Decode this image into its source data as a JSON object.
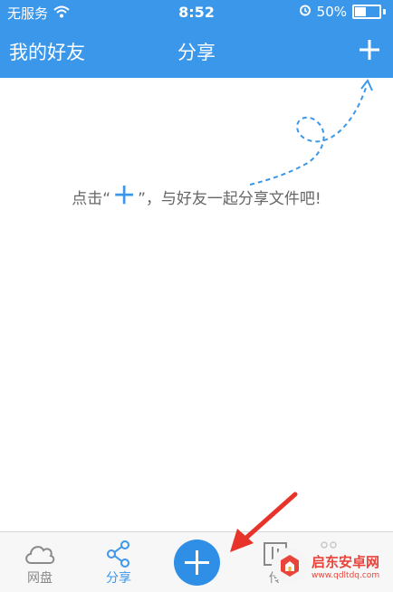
{
  "status_bar": {
    "carrier": "无服务",
    "time": "8:52",
    "battery_percent_label": "50%",
    "battery_level": 0.5
  },
  "nav": {
    "left_label": "我的好友",
    "title": "分享",
    "add_icon": "plus-icon"
  },
  "content": {
    "hint_prefix": "点击“",
    "hint_plus": "＋",
    "hint_suffix": "”，与好友一起分享文件吧!"
  },
  "tabs": [
    {
      "label": "网盘",
      "icon": "cloud-icon",
      "active": false
    },
    {
      "label": "分享",
      "icon": "share-icon",
      "active": true
    },
    {
      "label": "传输",
      "icon": "transfer-icon",
      "active": false
    },
    {
      "label": "",
      "icon": "more-icon",
      "active": false
    }
  ],
  "tab_partial_label": "传",
  "center_button": {
    "icon": "plus-icon"
  },
  "watermark": {
    "title": "启东安卓网",
    "url": "www.qdltdq.com"
  },
  "colors": {
    "primary": "#3b97ea",
    "annotation_arrow": "#e8332a"
  }
}
